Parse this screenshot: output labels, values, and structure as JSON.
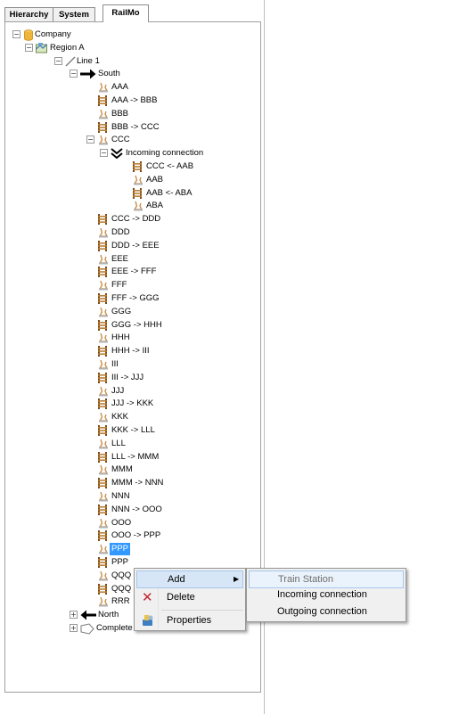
{
  "tabs": [
    {
      "label": "Hierarchy"
    },
    {
      "label": "System"
    },
    {
      "label": "RailMo"
    }
  ],
  "tree": {
    "company": "Company",
    "region": "Region A",
    "line": "Line 1",
    "south": "South",
    "nodes": [
      "AAA",
      "AAA -> BBB",
      "BBB",
      "BBB -> CCC",
      "CCC"
    ],
    "incoming": "Incoming connection",
    "incoming_children": [
      "CCC <- AAB",
      "AAB",
      "AAB <- ABA",
      "ABA"
    ],
    "nodes2": [
      "CCC -> DDD",
      "DDD",
      "DDD -> EEE",
      "EEE",
      "EEE -> FFF",
      "FFF",
      "FFF -> GGG",
      "GGG",
      "GGG -> HHH",
      "HHH",
      "HHH -> III",
      "III",
      "III -> JJJ",
      "JJJ",
      "JJJ -> KKK",
      "KKK",
      "KKK -> LLL",
      "LLL",
      "LLL -> MMM",
      "MMM",
      "MMM -> NNN",
      "NNN",
      "NNN -> OOO",
      "OOO",
      "OOO -> PPP",
      "PPP",
      "PPP",
      "QQQ",
      "QQQ",
      "RRR"
    ],
    "north": "North",
    "complete_route": "Complete route"
  },
  "context_menu": {
    "add": "Add",
    "delete": "Delete",
    "properties": "Properties"
  },
  "submenu": {
    "train_station": "Train Station",
    "incoming": "Incoming connection",
    "outgoing": "Outgoing connection"
  }
}
